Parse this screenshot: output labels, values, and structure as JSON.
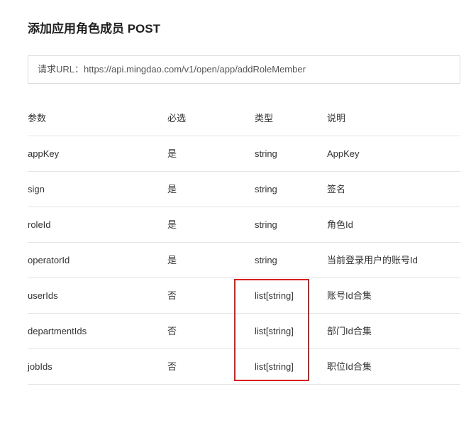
{
  "title": "添加应用角色成员 POST",
  "request_url": "请求URL：https://api.mingdao.com/v1/open/app/addRoleMember",
  "table": {
    "headers": [
      "参数",
      "必选",
      "类型",
      "说明"
    ],
    "rows": [
      [
        "appKey",
        "是",
        "string",
        "AppKey"
      ],
      [
        "sign",
        "是",
        "string",
        "签名"
      ],
      [
        "roleId",
        "是",
        "string",
        "角色Id"
      ],
      [
        "operatorId",
        "是",
        "string",
        "当前登录用户的账号Id"
      ],
      [
        "userIds",
        "否",
        "list[string]",
        "账号Id合集"
      ],
      [
        "departmentIds",
        "否",
        "list[string]",
        "部门Id合集"
      ],
      [
        "jobIds",
        "否",
        "list[string]",
        "职位Id合集"
      ]
    ]
  },
  "highlight_color": "#d81e1e"
}
